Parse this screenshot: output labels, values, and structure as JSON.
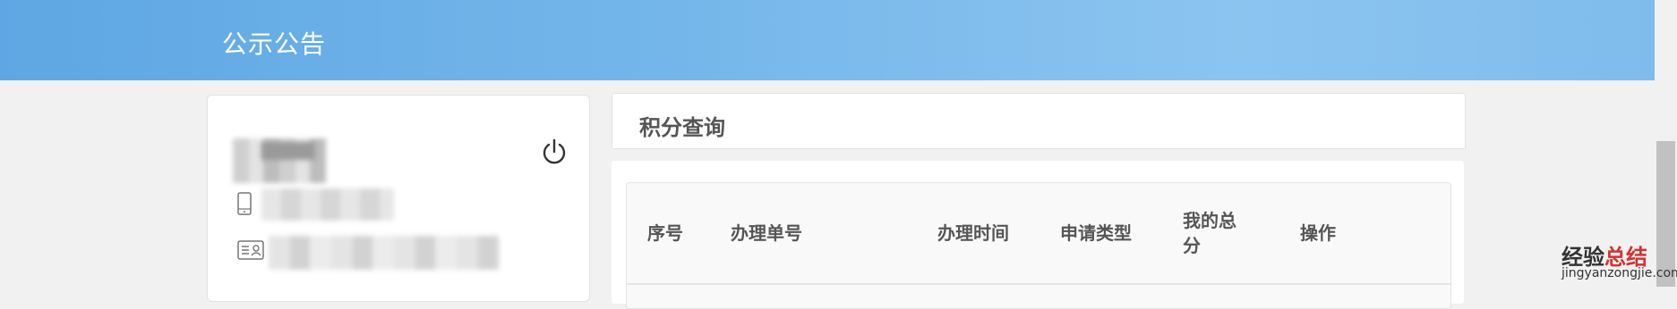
{
  "header": {
    "title": "公示公告"
  },
  "profile": {
    "icons": [
      "power-icon",
      "phone-icon",
      "id-card-icon"
    ]
  },
  "panel": {
    "title": "积分查询"
  },
  "table": {
    "columns": [
      "序号",
      "办理单号",
      "办理时间",
      "申请类型",
      "我的总分",
      "操作"
    ]
  },
  "watermark": {
    "text_a": "经验",
    "text_b": "总结",
    "url": "jingyanzongjie.com"
  },
  "colors": {
    "header_start": "#5ea7e4",
    "header_end": "#8cc4f0",
    "text": "#555555",
    "background": "#f1f1f1"
  }
}
